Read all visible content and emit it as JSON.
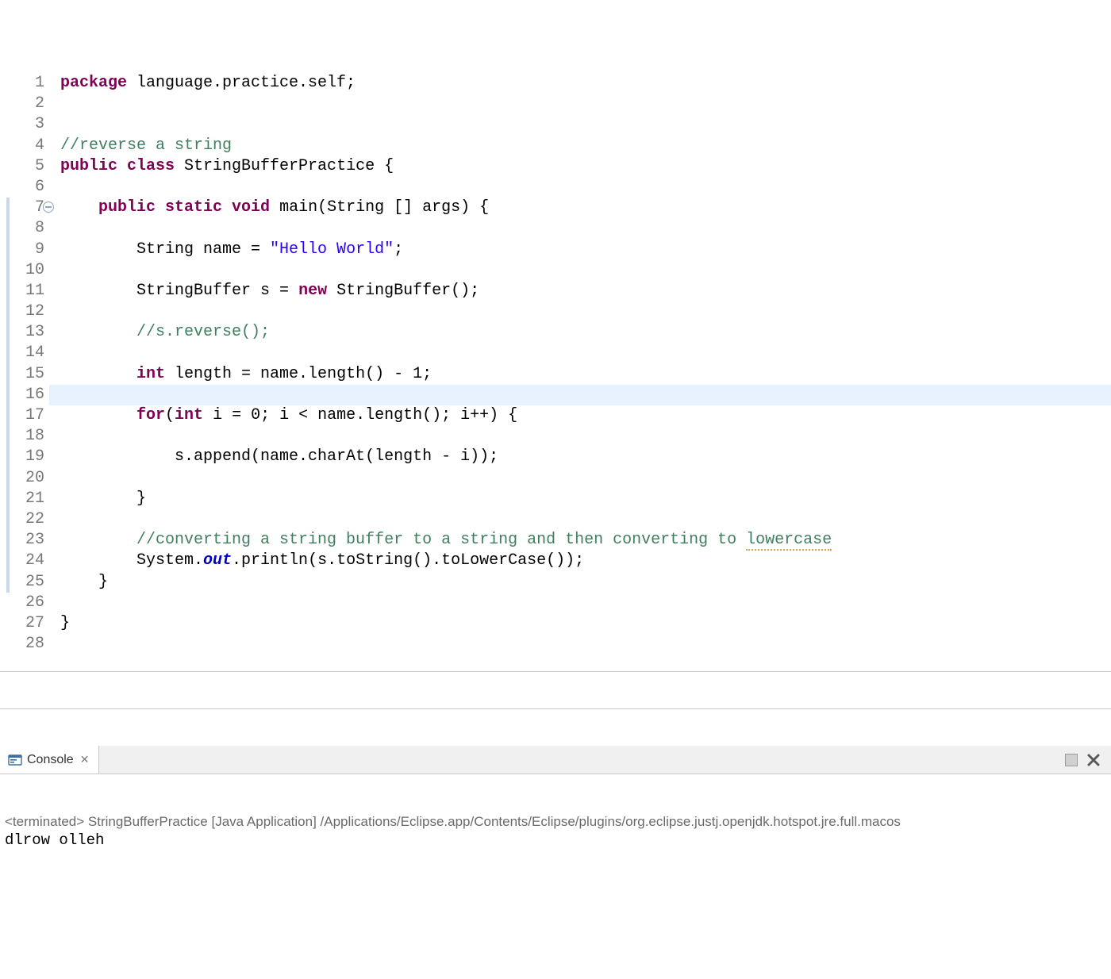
{
  "editor": {
    "highlight_line_index": 15,
    "changebar": {
      "from": 6,
      "to": 24
    },
    "fold_icon_line": 6,
    "lines": [
      {
        "n": 1,
        "tokens": [
          {
            "t": "package ",
            "c": "kw"
          },
          {
            "t": "language.practice.self;",
            "c": ""
          }
        ]
      },
      {
        "n": 2,
        "tokens": [
          {
            "t": "",
            "c": ""
          }
        ]
      },
      {
        "n": 3,
        "tokens": [
          {
            "t": "",
            "c": ""
          }
        ]
      },
      {
        "n": 4,
        "tokens": [
          {
            "t": "//reverse a string",
            "c": "cmt"
          }
        ]
      },
      {
        "n": 5,
        "tokens": [
          {
            "t": "public class ",
            "c": "kw"
          },
          {
            "t": "StringBufferPractice {",
            "c": ""
          }
        ]
      },
      {
        "n": 6,
        "tokens": [
          {
            "t": "",
            "c": ""
          }
        ]
      },
      {
        "n": 7,
        "tokens": [
          {
            "t": "    ",
            "c": ""
          },
          {
            "t": "public static void ",
            "c": "kw"
          },
          {
            "t": "main(String [] args) {",
            "c": ""
          }
        ]
      },
      {
        "n": 8,
        "tokens": [
          {
            "t": "",
            "c": ""
          }
        ]
      },
      {
        "n": 9,
        "tokens": [
          {
            "t": "        String name = ",
            "c": ""
          },
          {
            "t": "\"Hello World\"",
            "c": "str"
          },
          {
            "t": ";",
            "c": ""
          }
        ]
      },
      {
        "n": 10,
        "tokens": [
          {
            "t": "",
            "c": ""
          }
        ]
      },
      {
        "n": 11,
        "tokens": [
          {
            "t": "        StringBuffer s = ",
            "c": ""
          },
          {
            "t": "new ",
            "c": "kw"
          },
          {
            "t": "StringBuffer();",
            "c": ""
          }
        ]
      },
      {
        "n": 12,
        "tokens": [
          {
            "t": "",
            "c": ""
          }
        ]
      },
      {
        "n": 13,
        "tokens": [
          {
            "t": "        ",
            "c": ""
          },
          {
            "t": "//s.reverse();",
            "c": "cmt"
          }
        ]
      },
      {
        "n": 14,
        "tokens": [
          {
            "t": "",
            "c": ""
          }
        ]
      },
      {
        "n": 15,
        "tokens": [
          {
            "t": "        ",
            "c": ""
          },
          {
            "t": "int ",
            "c": "kw"
          },
          {
            "t": "length = name.length() - 1;",
            "c": ""
          }
        ]
      },
      {
        "n": 16,
        "tokens": [
          {
            "t": "        ",
            "c": ""
          }
        ]
      },
      {
        "n": 17,
        "tokens": [
          {
            "t": "        ",
            "c": ""
          },
          {
            "t": "for",
            "c": "kw"
          },
          {
            "t": "(",
            "c": ""
          },
          {
            "t": "int ",
            "c": "kw"
          },
          {
            "t": "i = 0; i < name.length(); i++) {",
            "c": ""
          }
        ]
      },
      {
        "n": 18,
        "tokens": [
          {
            "t": "",
            "c": ""
          }
        ]
      },
      {
        "n": 19,
        "tokens": [
          {
            "t": "            s.append(name.charAt(length - i));",
            "c": ""
          }
        ]
      },
      {
        "n": 20,
        "tokens": [
          {
            "t": "",
            "c": ""
          }
        ]
      },
      {
        "n": 21,
        "tokens": [
          {
            "t": "        }",
            "c": ""
          }
        ]
      },
      {
        "n": 22,
        "tokens": [
          {
            "t": "",
            "c": ""
          }
        ]
      },
      {
        "n": 23,
        "tokens": [
          {
            "t": "        ",
            "c": ""
          },
          {
            "t": "//converting a string buffer to a string and then converting to ",
            "c": "cmt"
          },
          {
            "t": "lowercase",
            "c": "cmt spellwarn"
          }
        ]
      },
      {
        "n": 24,
        "tokens": [
          {
            "t": "        System.",
            "c": ""
          },
          {
            "t": "out",
            "c": "it"
          },
          {
            "t": ".println(s.toString().toLowerCase());",
            "c": ""
          }
        ]
      },
      {
        "n": 25,
        "tokens": [
          {
            "t": "    }",
            "c": ""
          }
        ]
      },
      {
        "n": 26,
        "tokens": [
          {
            "t": "",
            "c": ""
          }
        ]
      },
      {
        "n": 27,
        "tokens": [
          {
            "t": "}",
            "c": ""
          }
        ]
      },
      {
        "n": 28,
        "tokens": [
          {
            "t": "",
            "c": ""
          }
        ]
      }
    ]
  },
  "console": {
    "tab_label": "Console",
    "close_glyph": "✕",
    "status": "<terminated> StringBufferPractice [Java Application] /Applications/Eclipse.app/Contents/Eclipse/plugins/org.eclipse.justj.openjdk.hotspot.jre.full.macos",
    "output": "dlrow olleh"
  }
}
